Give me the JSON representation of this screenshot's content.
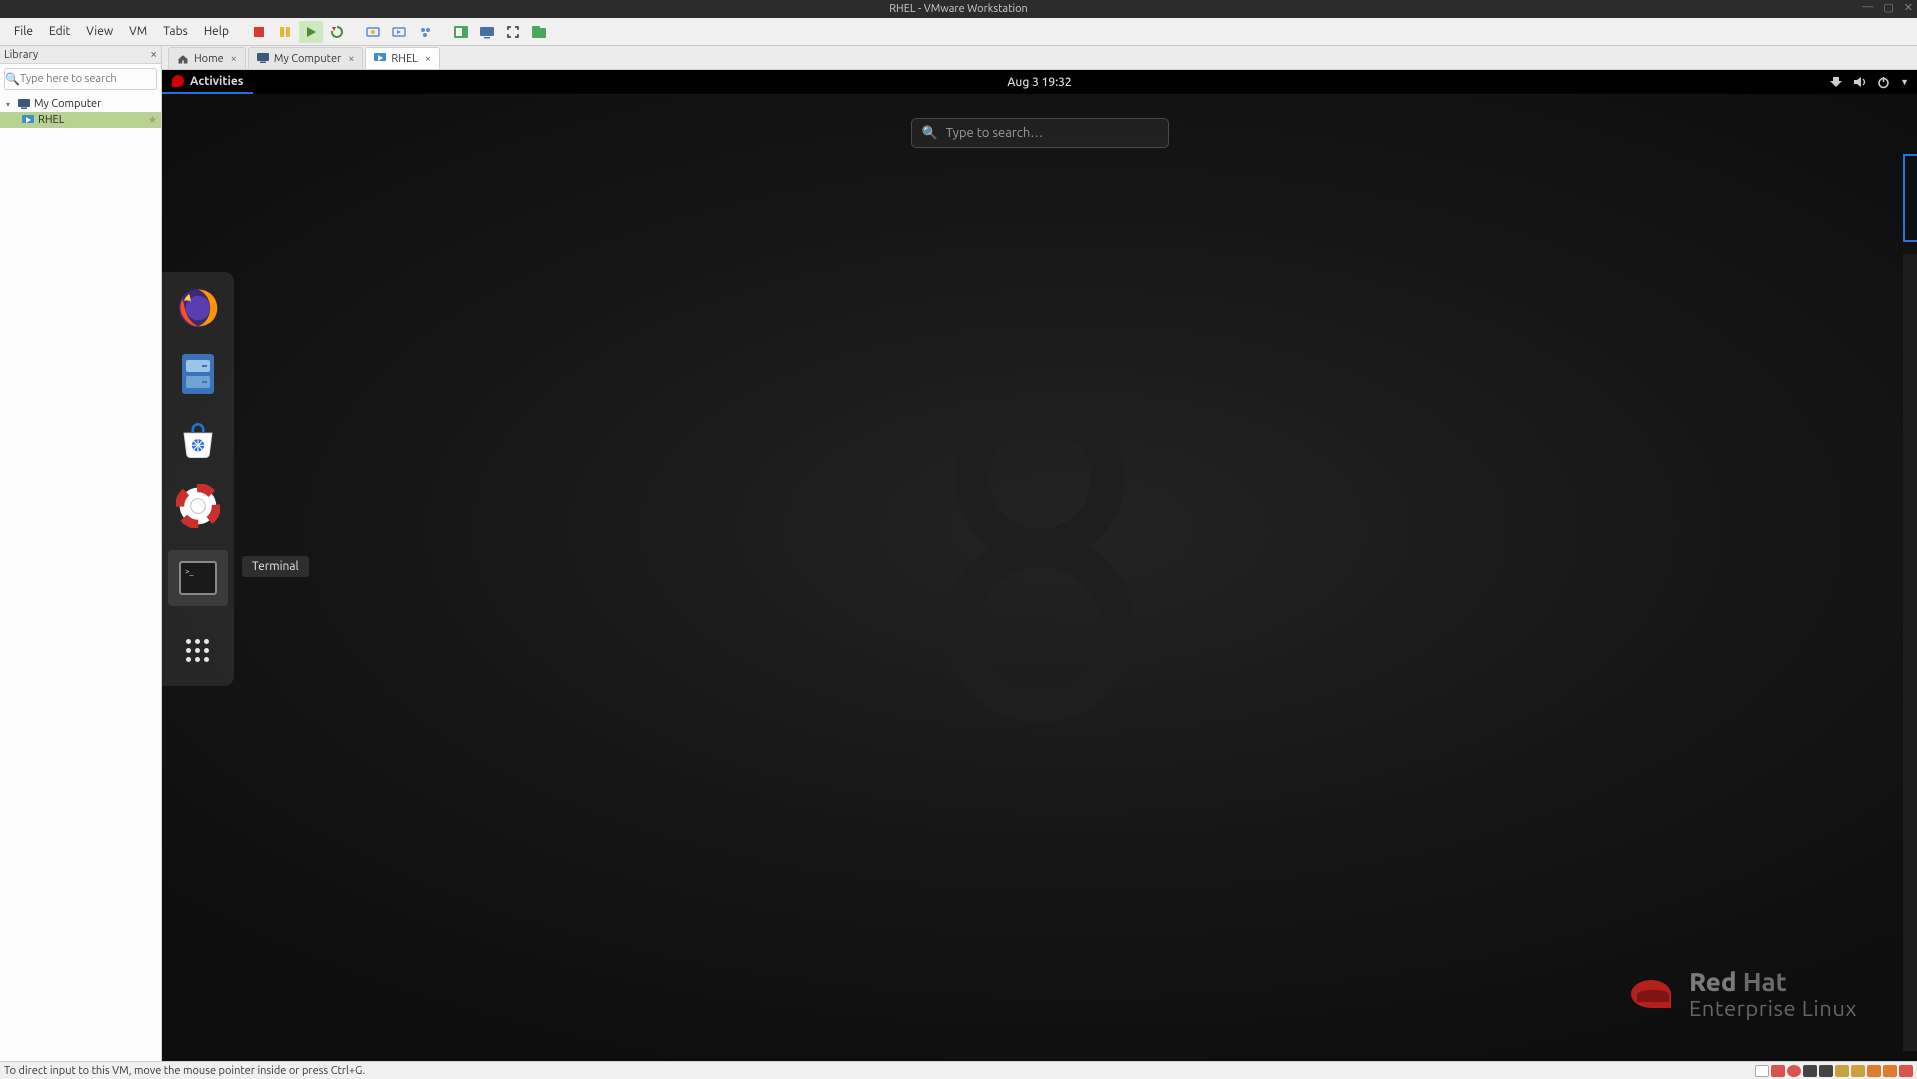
{
  "host": {
    "title": "RHEL - VMware Workstation",
    "window_controls": [
      "minimize",
      "maximize",
      "close"
    ]
  },
  "menu": {
    "items": [
      "File",
      "Edit",
      "View",
      "VM",
      "Tabs",
      "Help"
    ]
  },
  "toolbar": {
    "buttons": [
      {
        "name": "power-off-icon",
        "color": "#d73a2e"
      },
      {
        "name": "pause-icon",
        "color": "#e7b72e"
      },
      {
        "name": "play-icon",
        "color": "#6aa84f",
        "active": true
      },
      {
        "name": "restart-icon",
        "color": "#5a9e4b"
      },
      {
        "name": "snapshot-take-icon",
        "color": "#5b8bd0"
      },
      {
        "name": "snapshot-revert-icon",
        "color": "#5b8bd0"
      },
      {
        "name": "snapshot-manage-icon",
        "color": "#5b8bd0"
      },
      {
        "name": "unity-icon",
        "color": "#49a85e"
      },
      {
        "name": "console-icon",
        "color": "#4a6fa7"
      },
      {
        "name": "fullscreen-icon",
        "color": "#333333"
      },
      {
        "name": "library-icon",
        "color": "#49a85e"
      }
    ]
  },
  "library": {
    "title": "Library",
    "search_placeholder": "Type here to search",
    "tree": {
      "root": "My Computer",
      "children": [
        {
          "label": "RHEL",
          "selected": true
        }
      ]
    }
  },
  "tabs": [
    {
      "name": "home",
      "label": "Home",
      "icon": "home-icon"
    },
    {
      "name": "mycomputer",
      "label": "My Computer",
      "icon": "computer-icon"
    },
    {
      "name": "rhel",
      "label": "RHEL",
      "icon": "vm-icon",
      "active": true
    }
  ],
  "guest": {
    "activities_label": "Activities",
    "clock": "Aug 3  19:32",
    "search_placeholder": "Type to search…",
    "dash": [
      {
        "name": "firefox",
        "tooltip": "Firefox"
      },
      {
        "name": "files",
        "tooltip": "Files"
      },
      {
        "name": "software",
        "tooltip": "Software"
      },
      {
        "name": "help",
        "tooltip": "Help"
      },
      {
        "name": "terminal",
        "tooltip": "Terminal",
        "hover": true
      },
      {
        "name": "show-apps",
        "tooltip": "Show Applications"
      }
    ],
    "tooltip_visible": "Terminal",
    "branding": {
      "line1_a": "Red",
      "line1_b": "Hat",
      "line2": "Enterprise Linux"
    },
    "sysicons": [
      "network-icon",
      "volume-icon",
      "power-icon",
      "chevron-down-icon"
    ]
  },
  "statusbar": {
    "hint": "To direct input to this VM, move the mouse pointer inside or press Ctrl+G.",
    "tray_icons": [
      "hdd-icon",
      "cd-icon",
      "floppy-icon",
      "net-icon",
      "printer-icon",
      "display-icon",
      "usb-icon",
      "sound-icon",
      "badge-icon"
    ]
  }
}
